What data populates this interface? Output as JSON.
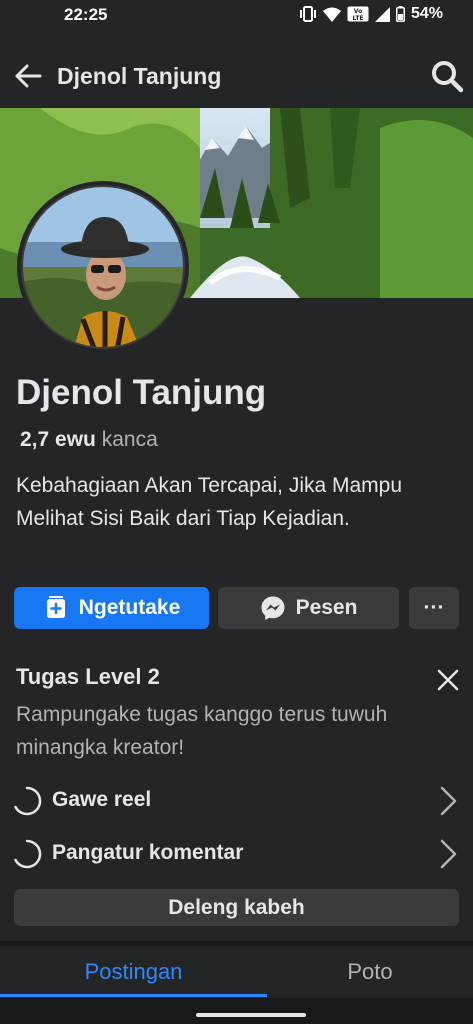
{
  "status_bar": {
    "time": "22:25",
    "network_badge": "VoLTE",
    "battery": "54%",
    "icons": [
      "vibrate-icon",
      "wifi-icon",
      "volte-icon",
      "signal-icon",
      "battery-icon"
    ]
  },
  "header": {
    "title": "Djenol Tanjung",
    "back_icon": "arrow-left-icon",
    "search_icon": "search-icon"
  },
  "profile": {
    "name": "Djenol Tanjung",
    "friends_count": "2,7 ewu",
    "friends_label": "kanca",
    "bio": "Kebahagiaan Akan Tercapai, Jika Mampu Melihat Sisi Baik dari Tiap Kejadian."
  },
  "actions": {
    "primary_label": "Ngetutake",
    "primary_icon": "add-to-story-icon",
    "message_label": "Pesen",
    "message_icon": "messenger-icon",
    "more_label": "···"
  },
  "tasks": {
    "title": "Tugas Level 2",
    "description": "Rampungake tugas kanggo terus tuwuh minangka kreator!",
    "items": [
      {
        "label": "Gawe reel"
      },
      {
        "label": "Pangatur komentar"
      }
    ],
    "see_all_label": "Deleng kabeh"
  },
  "tabs": [
    {
      "label": "Postingan",
      "active": true
    },
    {
      "label": "Poto",
      "active": false
    }
  ],
  "colors": {
    "background": "#242526",
    "primary": "#1877f2",
    "secondary_button": "#3a3b3c",
    "active_tab": "#2d88ff",
    "text": "#e4e6eb",
    "muted_text": "#b0b3b8"
  }
}
